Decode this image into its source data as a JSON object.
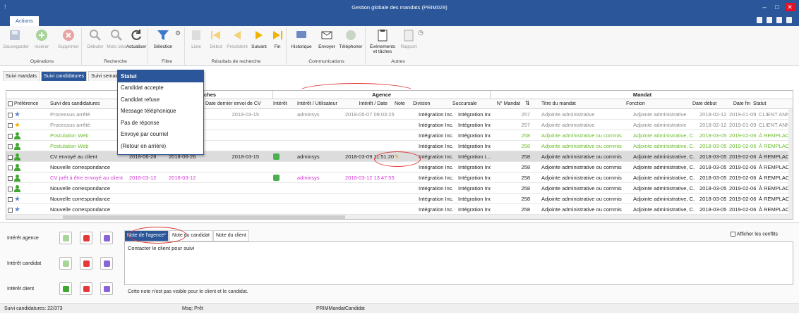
{
  "window": {
    "title": "Gestion globale des mandats (PRIM029)"
  },
  "ribbon": {
    "tab": "Actions",
    "groups": [
      {
        "label": "Opérations",
        "buttons": [
          "Sauvegarder",
          "Insérer",
          "Supprimer"
        ]
      },
      {
        "label": "Recherche",
        "buttons": [
          "Débuter",
          "Mots clés",
          "Actualiser"
        ]
      },
      {
        "label": "Filtre",
        "buttons": [
          "Sélection"
        ]
      },
      {
        "label": "Résultats de recherche",
        "buttons": [
          "Liste",
          "Début",
          "Précédent",
          "Suivant",
          "Fin"
        ]
      },
      {
        "label": "Communications",
        "buttons": [
          "Historique",
          "Envoyer",
          "Téléphoner"
        ]
      },
      {
        "label": "Autres",
        "buttons": [
          "Événements et tâches",
          "Rapport"
        ]
      }
    ]
  },
  "nav_tabs": [
    "Suivi mandats",
    "Suivi candidatures",
    "Suivi semaines"
  ],
  "statut_popup": {
    "title": "Statut",
    "items": [
      "Candidat accepte",
      "Candidat refuse",
      "Message téléphonique",
      "Pas de réponse",
      "Envoyé par courriel",
      "(Retour en arrière)"
    ]
  },
  "grid": {
    "bands": {
      "mid": "ches",
      "agence": "Agence",
      "mandat": "Mandat"
    },
    "headers": {
      "preference": "Préférence",
      "suivi": "Suivi des candidatures",
      "date_envoi": "Date dernier envoi de CV",
      "interet": "Intérêt",
      "interet_user": "Intérêt / Utilisateur",
      "interet_date": "Intérêt / Date",
      "note": "Note",
      "division": "Division",
      "succursale": "Succursale",
      "no_mandat": "N° Mandat",
      "titre": "Titre du mandat",
      "fonction": "Fonction",
      "date_debut": "Date début",
      "date_fin": "Date fin",
      "statut": "Statut"
    },
    "rows": [
      {
        "icon": "star",
        "suivi": "Processus arrêté",
        "d1": "",
        "d2": "",
        "date_envoi": "2018-03-15",
        "interet": false,
        "user": "adminsys",
        "idate": "2018-05-07 09:03:25",
        "division": "Intégration Inc.",
        "succursale": "Intégration Inc.",
        "no": "257",
        "titre": "Adjointe administrative",
        "fonction": "Adjointe administrative",
        "debut": "2018-02-12",
        "fin": "2019-01-09",
        "statut": "CLIENT ANNULÉ",
        "color": "#8a8a8a"
      },
      {
        "icon": "star-gold",
        "suivi": "Processus arrêté",
        "d1": "",
        "d2": "",
        "date_envoi": "",
        "interet": false,
        "user": "",
        "idate": "",
        "division": "Intégration Inc.",
        "succursale": "Intégration Inc.",
        "no": "257",
        "titre": "Adjointe administrative",
        "fonction": "Adjointe administrative",
        "debut": "2018-02-12",
        "fin": "2019-01-09",
        "statut": "CLIENT ANNULÉ",
        "color": "#8a8a8a"
      },
      {
        "icon": "person",
        "suivi": "Postulation Web",
        "d1": "",
        "d2": "",
        "date_envoi": "",
        "interet": false,
        "user": "",
        "idate": "",
        "division": "Intégration Inc.",
        "succursale": "Intégration Inc.",
        "no": "258",
        "titre": "Adjointe administrative ou commis",
        "fonction": "Adjointe administrative, C...",
        "debut": "2018-03-05",
        "fin": "2019-02-06",
        "statut": "À REMPLACER",
        "color": "#6cbd2b"
      },
      {
        "icon": "person",
        "suivi": "Postulation Web",
        "d1": "",
        "d2": "",
        "date_envoi": "",
        "interet": false,
        "user": "",
        "idate": "",
        "division": "Intégration Inc.",
        "succursale": "Intégration Inc.",
        "no": "258",
        "titre": "Adjointe administrative ou commis",
        "fonction": "Adjointe administrative, C...",
        "debut": "2018-03-05",
        "fin": "2019-02-06",
        "statut": "À REMPLACER",
        "color": "#6cbd2b"
      },
      {
        "icon": "person",
        "suivi": "CV envoyé au client",
        "d1": "2018-06-28",
        "d2": "2018-06-26",
        "date_envoi": "2018-03-15",
        "interet": true,
        "user": "adminsys",
        "idate": "2018-03-09 11:51:20",
        "division": "Intégration Inc.",
        "succursale": "Intégration I...",
        "no": "258",
        "titre": "Adjointe administrative ou commis",
        "fonction": "Adjointe administrative, C...",
        "debut": "2018-03-05",
        "fin": "2019-02-06",
        "statut": "À REMPLACER",
        "color": "#222",
        "selected": true
      },
      {
        "icon": "person",
        "suivi": "Nouvelle correspondance",
        "d1": "",
        "d2": "",
        "date_envoi": "",
        "interet": false,
        "user": "",
        "idate": "",
        "division": "Intégration Inc.",
        "succursale": "Intégration Inc.",
        "no": "258",
        "titre": "Adjointe administrative ou commis",
        "fonction": "Adjointe administrative, C...",
        "debut": "2018-03-05",
        "fin": "2019-02-06",
        "statut": "À REMPLACER",
        "color": "#222"
      },
      {
        "icon": "person",
        "suivi": "CV prêt à être envoyé au client",
        "d1": "2018-03-12",
        "d2": "2018-03-12",
        "date_envoi": "",
        "interet": true,
        "user": "adminsys",
        "idate": "2018-03-12 13:47:55",
        "division": "Intégration Inc.",
        "succursale": "Intégration Inc.",
        "no": "258",
        "titre": "Adjointe administrative ou commis",
        "fonction": "Adjointe administrative, C...",
        "debut": "2018-03-05",
        "fin": "2019-02-06",
        "statut": "À REMPLACER",
        "color": "#d43bd4"
      },
      {
        "icon": "person",
        "suivi": "Nouvelle correspondance",
        "d1": "",
        "d2": "",
        "date_envoi": "",
        "interet": false,
        "user": "",
        "idate": "",
        "division": "Intégration Inc.",
        "succursale": "Intégration Inc.",
        "no": "258",
        "titre": "Adjointe administrative ou commis",
        "fonction": "Adjointe administrative, C...",
        "debut": "2018-03-05",
        "fin": "2019-02-06",
        "statut": "À REMPLACER",
        "color": "#222"
      },
      {
        "icon": "star",
        "suivi": "Nouvelle correspondance",
        "d1": "",
        "d2": "",
        "date_envoi": "",
        "interet": false,
        "user": "",
        "idate": "",
        "division": "Intégration Inc.",
        "succursale": "Intégration Inc.",
        "no": "258",
        "titre": "Adjointe administrative ou commis",
        "fonction": "Adjointe administrative, C...",
        "debut": "2018-03-05",
        "fin": "2019-02-06",
        "statut": "À REMPLACER",
        "color": "#222"
      },
      {
        "icon": "star",
        "suivi": "Nouvelle correspondance",
        "d1": "",
        "d2": "",
        "date_envoi": "",
        "interet": false,
        "user": "",
        "idate": "",
        "division": "Intégration Inc.",
        "succursale": "Intégration Inc.",
        "no": "258",
        "titre": "Adjointe administrative ou commis",
        "fonction": "Adjointe administrative, C...",
        "debut": "2018-03-05",
        "fin": "2019-02-06",
        "statut": "À REMPLACER",
        "color": "#222"
      }
    ]
  },
  "interest": {
    "agence": "Intérêt agence",
    "candidat": "Intérêt candidat",
    "client": "Intérêt client"
  },
  "notes": {
    "tabs": [
      "Note de l'agence*",
      "Note du candidat",
      "Note du client"
    ],
    "text": "Contacter le client pour suivi",
    "footer": "Cette note n'est pas visible pour le client et le candidat.",
    "afficher": "Afficher les conflits"
  },
  "status": {
    "left": "Suivi candidatures: 22/373",
    "mid": "Msq: Prêt",
    "right": "PRIMMandatCandidat"
  },
  "colors": {
    "accent": "#2b579a",
    "annotation": "#e03b3b"
  }
}
